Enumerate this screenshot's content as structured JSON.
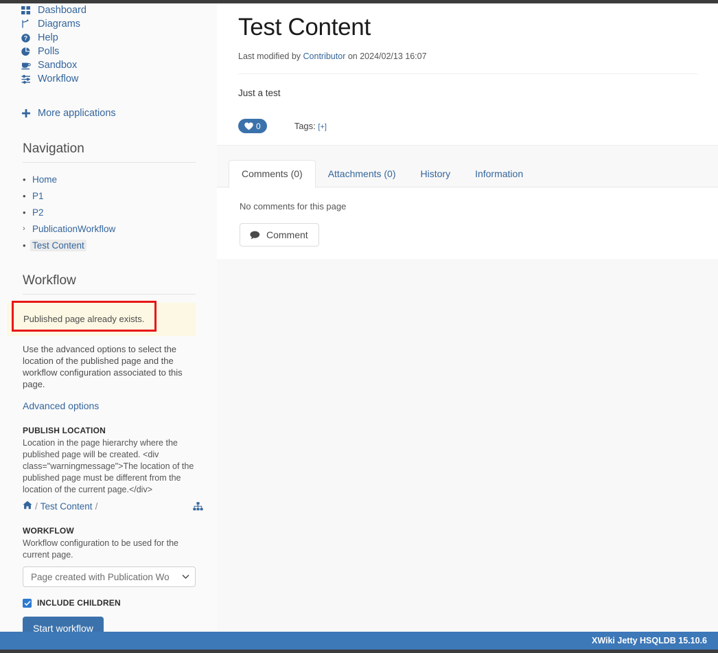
{
  "applications": {
    "items": [
      {
        "label": "Dashboard",
        "icon": "grid-icon"
      },
      {
        "label": "Diagrams",
        "icon": "diagram-branch-icon"
      },
      {
        "label": "Help",
        "icon": "question-circle-icon"
      },
      {
        "label": "Polls",
        "icon": "pie-chart-icon"
      },
      {
        "label": "Sandbox",
        "icon": "coffee-cup-icon"
      },
      {
        "label": "Workflow",
        "icon": "sliders-icon"
      }
    ],
    "more_label": "More applications",
    "more_icon": "plus-icon"
  },
  "navigation": {
    "title": "Navigation",
    "items": [
      {
        "label": "Home",
        "marker": "bullet",
        "selected": false
      },
      {
        "label": "P1",
        "marker": "bullet",
        "selected": false
      },
      {
        "label": "P2",
        "marker": "bullet",
        "selected": false
      },
      {
        "label": "PublicationWorkflow",
        "marker": "caret",
        "selected": false
      },
      {
        "label": "Test Content",
        "marker": "bullet",
        "selected": true
      }
    ]
  },
  "workflow_panel": {
    "title": "Workflow",
    "warning_message": "Published page already exists.",
    "description": "Use the advanced options to select the location of the published page and the workflow configuration associated to this page.",
    "advanced_options_link": "Advanced options",
    "publish_location": {
      "label": "PUBLISH LOCATION",
      "hint": "Location in the page hierarchy where the published page will be created. <div class=\"warningmessage\">The location of the published page must be different from the location of the current page.</div>",
      "breadcrumb": {
        "home_icon": "home-icon",
        "separator_1": "/",
        "crumb": "Test Content",
        "separator_2": "/",
        "tree_icon": "sitemap-tree-icon"
      }
    },
    "workflow_config": {
      "label": "WORKFLOW",
      "hint": "Workflow configuration to be used for the current page.",
      "selected_option": "Page created with Publication Wo",
      "chevron_icon": "chevron-down-icon"
    },
    "include_children": {
      "label": "INCLUDE CHILDREN",
      "checked": true,
      "icon": "checkmark-icon"
    },
    "start_button": "Start workflow"
  },
  "document": {
    "title": "Test Content",
    "meta_prefix": "Last modified by",
    "meta_author": "Contributor",
    "meta_middle": "on",
    "meta_date": "2024/02/13 16:07",
    "body": "Just a test",
    "like": {
      "icon": "heart-icon",
      "count": "0"
    },
    "tags": {
      "label": "Tags:",
      "add": "[+]"
    }
  },
  "tabs": {
    "items": [
      {
        "label": "Comments (0)",
        "active": true
      },
      {
        "label": "Attachments (0)",
        "active": false
      },
      {
        "label": "History",
        "active": false
      },
      {
        "label": "Information",
        "active": false
      }
    ],
    "comments_panel": {
      "empty_text": "No comments for this page",
      "button_label": "Comment",
      "button_icon": "comment-bubble-icon"
    }
  },
  "footer": {
    "text": "XWiki Jetty HSQLDB 15.10.6"
  },
  "colors": {
    "link": "#34659c",
    "accent": "#3b72ab",
    "warning_bg": "#fcf8e3",
    "annotation_red": "#e81717",
    "footer_bg": "#3d78b8",
    "topbar": "#3c3c3c"
  }
}
